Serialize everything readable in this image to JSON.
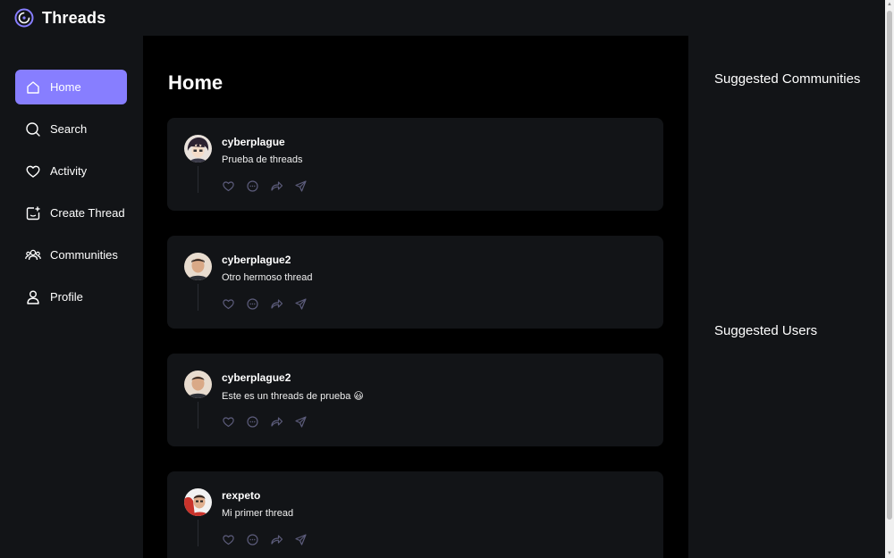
{
  "app": {
    "brand": "Threads",
    "accent": "#877eff"
  },
  "sidebar": {
    "items": [
      {
        "label": "Home",
        "icon": "home-icon",
        "active": true
      },
      {
        "label": "Search",
        "icon": "search-icon"
      },
      {
        "label": "Activity",
        "icon": "heart-icon"
      },
      {
        "label": "Create Thread",
        "icon": "create-thread-icon"
      },
      {
        "label": "Communities",
        "icon": "communities-icon"
      },
      {
        "label": "Profile",
        "icon": "user-icon"
      }
    ]
  },
  "main": {
    "title": "Home",
    "threads": [
      {
        "author": "cyberplague",
        "text": "Prueba de threads",
        "avatar": "anime-avatar"
      },
      {
        "author": "cyberplague2",
        "text": "Otro hermoso thread",
        "avatar": "person-avatar"
      },
      {
        "author": "cyberplague2",
        "text": "Este es un threads de prueba 😃",
        "avatar": "person-avatar"
      },
      {
        "author": "rexpeto",
        "text": "Mi primer thread",
        "avatar": "person-red-avatar"
      }
    ],
    "actions": [
      "heart-icon",
      "reply-icon",
      "repost-icon",
      "share-icon"
    ]
  },
  "rightbar": {
    "suggested_communities": "Suggested Communities",
    "suggested_users": "Suggested Users"
  }
}
